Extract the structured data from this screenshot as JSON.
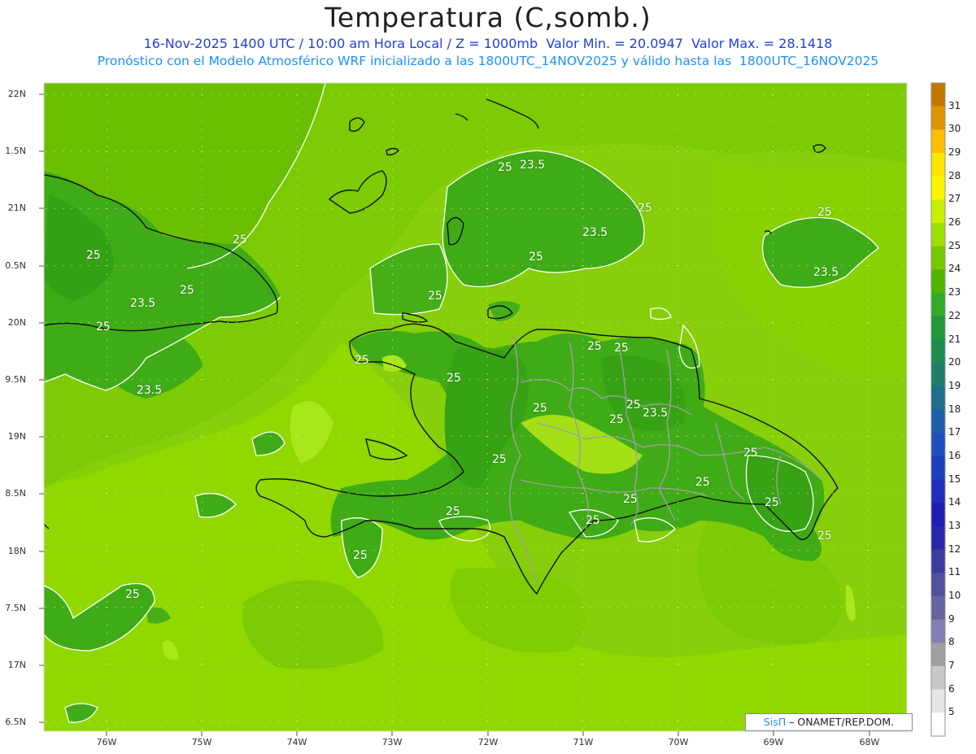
{
  "header": {
    "title": "Temperatura (C,somb.)",
    "line1": "16-Nov-2025 1400 UTC / 10:00 am Hora Local / Z = 1000mb  Valor Min. = 20.0947  Valor Max. = 28.1418",
    "line2": "Pronóstico con el Modelo Atmosférico WRF inicializado a las 1800UTC_14NOV2025 y válido hasta las  1800UTC_16NOV2025"
  },
  "axes": {
    "lat_labels": [
      "22N",
      "1.5N",
      "21N",
      "0.5N",
      "20N",
      "9.5N",
      "19N",
      "8.5N",
      "18N",
      "7.5N",
      "17N",
      "6.5N"
    ],
    "lon_labels": [
      "76W",
      "75W",
      "74W",
      "73W",
      "72W",
      "71W",
      "70W",
      "69W",
      "68W"
    ]
  },
  "colorbar": {
    "labels": [
      "31",
      "30",
      "29",
      "28",
      "27",
      "26",
      "25",
      "24",
      "23",
      "22",
      "21",
      "20",
      "19",
      "18",
      "17",
      "16",
      "15",
      "14",
      "13",
      "12",
      "11",
      "10",
      "9",
      "8",
      "7",
      "6",
      "5"
    ],
    "colors": [
      "#c47800",
      "#e09400",
      "#ffbe00",
      "#ffe600",
      "#fff500",
      "#c8f000",
      "#a0e000",
      "#78c800",
      "#50b400",
      "#32aa28",
      "#1e9a3c",
      "#1e8c50",
      "#1e7e6a",
      "#1e6e8c",
      "#1e5eaa",
      "#1e4ebe",
      "#1e3ebe",
      "#1e2ebe",
      "#1e1eb4",
      "#2828aa",
      "#3c3ca0",
      "#5050a0",
      "#6464a0",
      "#8080b4",
      "#a0a0a0",
      "#c8c8c8",
      "#e6e6e6",
      "#ffffff"
    ]
  },
  "contour_labels": [
    "25",
    "23.5",
    "25",
    "23.5",
    "25",
    "25",
    "23.5",
    "25",
    "25",
    "25",
    "23.5",
    "25",
    "23.5",
    "25",
    "25",
    "25",
    "25",
    "25",
    "25",
    "25",
    "25",
    "23.5",
    "25",
    "25",
    "25",
    "25",
    "25",
    "25",
    "25",
    "25",
    "25",
    "25"
  ],
  "credit": {
    "brand": "SisΠ",
    "text": " – ONAMET/REP.DOM."
  },
  "palette": {
    "light_green": "#8fd600",
    "mid_green": "#6fc200",
    "dark_green": "#3aa819",
    "lime": "#a8e81a",
    "coast": "#111111",
    "borders": "#a0a0a0"
  }
}
